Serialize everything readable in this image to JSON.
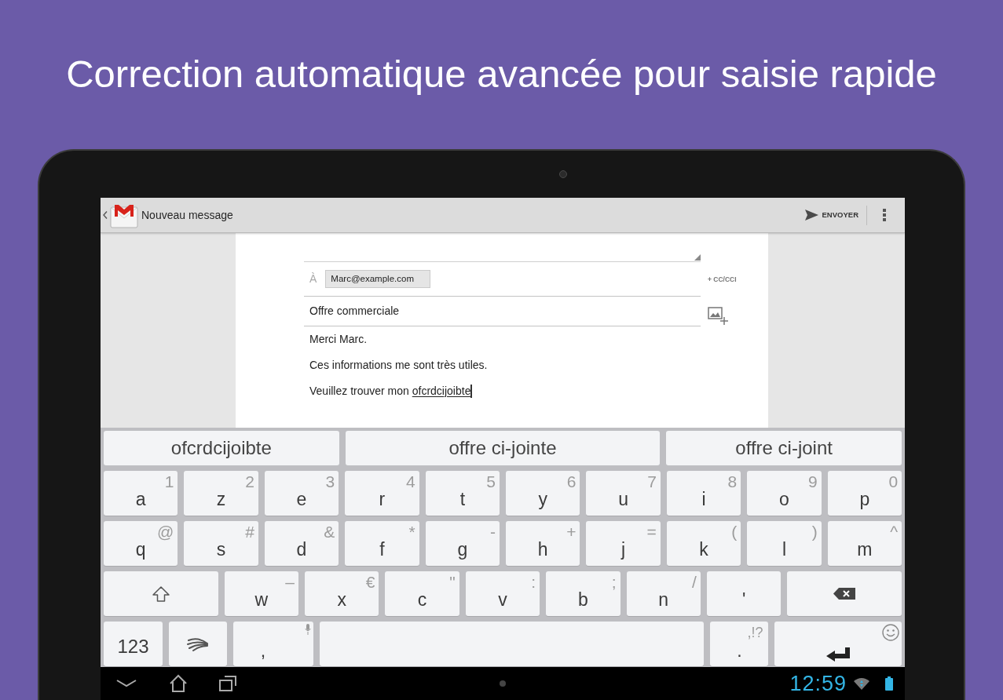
{
  "headline": "Correction automatique avancée pour saisie rapide",
  "app_bar": {
    "title": "Nouveau message",
    "send_label": "ENVOYER"
  },
  "compose": {
    "to_label": "À",
    "recipient": "Marc@example.com",
    "cc_label": "+ CC/CCI",
    "subject": "Offre commerciale",
    "body": [
      {
        "text": "Merci Marc.",
        "cursor": false
      },
      {
        "text": "Ces informations me sont très utiles.",
        "cursor": false
      },
      {
        "text": "Veuillez trouver mon",
        "composing": "ofcrdcijoibte",
        "cursor": true
      }
    ]
  },
  "keyboard": {
    "suggestions": [
      "ofcrdcijoibte",
      "offre ci-jointe",
      "offre ci-joint"
    ],
    "rows": [
      [
        {
          "kind": "char",
          "label": "a",
          "hint": "1"
        },
        {
          "kind": "char",
          "label": "z",
          "hint": "2"
        },
        {
          "kind": "char",
          "label": "e",
          "hint": "3"
        },
        {
          "kind": "char",
          "label": "r",
          "hint": "4"
        },
        {
          "kind": "char",
          "label": "t",
          "hint": "5"
        },
        {
          "kind": "char",
          "label": "y",
          "hint": "6"
        },
        {
          "kind": "char",
          "label": "u",
          "hint": "7"
        },
        {
          "kind": "char",
          "label": "i",
          "hint": "8"
        },
        {
          "kind": "char",
          "label": "o",
          "hint": "9"
        },
        {
          "kind": "char",
          "label": "p",
          "hint": "0"
        }
      ],
      [
        {
          "kind": "char",
          "label": "q",
          "hint": "@"
        },
        {
          "kind": "char",
          "label": "s",
          "hint": "#"
        },
        {
          "kind": "char",
          "label": "d",
          "hint": "&"
        },
        {
          "kind": "char",
          "label": "f",
          "hint": "*"
        },
        {
          "kind": "char",
          "label": "g",
          "hint": "-"
        },
        {
          "kind": "char",
          "label": "h",
          "hint": "+"
        },
        {
          "kind": "char",
          "label": "j",
          "hint": "="
        },
        {
          "kind": "char",
          "label": "k",
          "hint": "("
        },
        {
          "kind": "char",
          "label": "l",
          "hint": ")"
        },
        {
          "kind": "char",
          "label": "m",
          "hint": "^"
        }
      ],
      [
        {
          "kind": "shift"
        },
        {
          "kind": "char",
          "label": "w",
          "hint": "–"
        },
        {
          "kind": "char",
          "label": "x",
          "hint": "€"
        },
        {
          "kind": "char",
          "label": "c",
          "hint": "\""
        },
        {
          "kind": "char",
          "label": "v",
          "hint": ":"
        },
        {
          "kind": "char",
          "label": "b",
          "hint": ";"
        },
        {
          "kind": "char",
          "label": "n",
          "hint": "/"
        },
        {
          "kind": "char",
          "label": "'"
        },
        {
          "kind": "backspace"
        }
      ],
      [
        {
          "kind": "symbols",
          "label": "123"
        },
        {
          "kind": "swype"
        },
        {
          "kind": "voice",
          "label": ","
        },
        {
          "kind": "space"
        },
        {
          "kind": "period",
          "label": ".",
          "hint": ",!?"
        },
        {
          "kind": "enter"
        }
      ]
    ]
  },
  "status_bar": {
    "time": "12:59"
  }
}
